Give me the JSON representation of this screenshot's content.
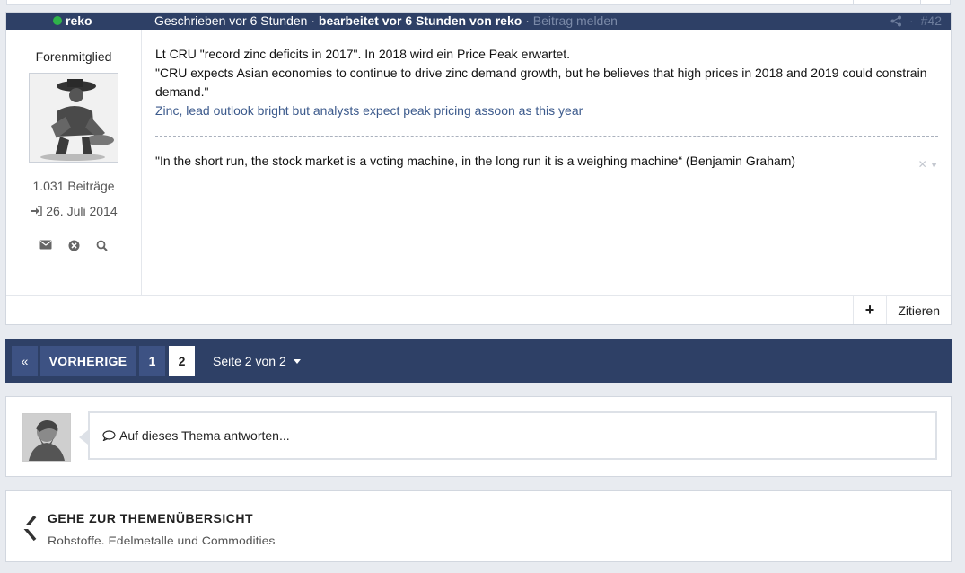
{
  "post": {
    "username": "reko",
    "written": "Geschrieben vor 6 Stunden",
    "edited": "bearbeitet vor 6 Stunden von reko",
    "report": "Beitrag melden",
    "post_number": "#42",
    "rank": "Forenmitglied",
    "post_count": "1.031 Beiträge",
    "joined": "26. Juli 2014",
    "content": {
      "line1": "Lt CRU \"record zinc deficits in 2017\". In 2018 wird ein Price Peak erwartet.",
      "line2": "\"CRU expects Asian economies to continue to drive zinc demand growth, but he believes that high prices in 2018 and 2019 could constrain demand.\"",
      "link": "Zinc, lead outlook bright but analysts expect peak pricing assoon as this year"
    },
    "signature": "\"In the short run, the stock market is a voting machine, in the long run it is a weighing machine“ (Benjamin Graham)",
    "footer": {
      "plus": "+",
      "quote": "Zitieren"
    }
  },
  "pagination": {
    "prev_icon": "«",
    "prev_label": "VORHERIGE",
    "pages": [
      "1",
      "2"
    ],
    "current": "2",
    "info": "Seite 2 von 2"
  },
  "reply": {
    "placeholder": "Auf dieses Thema antworten..."
  },
  "overview": {
    "title": "GEHE ZUR THEMENÜBERSICHT",
    "subtitle": "Rohstoffe, Edelmetalle und Commodities"
  },
  "colors": {
    "header_bg": "#2e4066",
    "online": "#2fb34a",
    "link": "#3c5a8c"
  },
  "icons": [
    "share-icon",
    "envelope-icon",
    "block-icon",
    "search-icon",
    "login-icon",
    "comment-icon",
    "chevron-left-icon",
    "caret-down-icon"
  ]
}
